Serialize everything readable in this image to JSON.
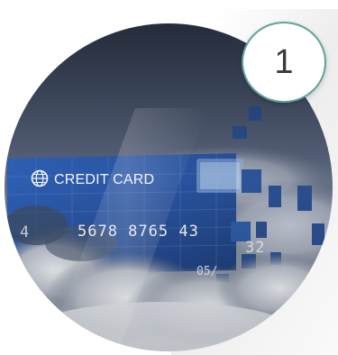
{
  "card": {
    "brand_label": "CREDIT CARD",
    "number_visible": "5678 8765 43",
    "number_lead_fragment": "4",
    "expiry_fragment": "05/",
    "side_fragment": "32"
  },
  "badge": {
    "number": "1",
    "ring_color": "#5fa39a"
  },
  "icons": {
    "globe": "globe-icon"
  },
  "colors": {
    "card_blue": "#2b5bb0",
    "sky_dark": "#3c4a63",
    "cloud": "#d9dde4"
  }
}
